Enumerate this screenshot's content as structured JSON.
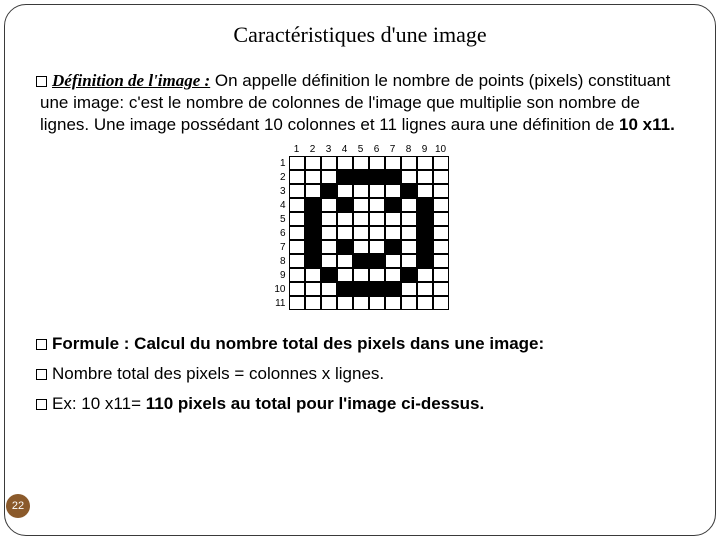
{
  "slide": {
    "title": "Caractéristiques d'une image",
    "page_number": "22"
  },
  "para1": {
    "lead": "Définition de l'image :",
    "rest_a": " On appelle définition le nombre de points (pixels) constituant une image: c'est le nombre de colonnes de l'image que multiplie son nombre de lignes. Une image possédant 10 colonnes et 11 lignes aura une définition de ",
    "bold_tail": "10 x11."
  },
  "para2": {
    "lead": "Formule : Calcul du nombre total des pixels dans une image:"
  },
  "para3": {
    "text": "Nombre total des pixels = colonnes x lignes."
  },
  "para4": {
    "pre": "Ex: 10 x11= ",
    "bold": "110 pixels au total pour l'image ci-dessus."
  },
  "chart_data": {
    "type": "table",
    "title": "Pixel grid 10x11 smiley",
    "columns": [
      "1",
      "2",
      "3",
      "4",
      "5",
      "6",
      "7",
      "8",
      "9",
      "10"
    ],
    "rows": [
      "1",
      "2",
      "3",
      "4",
      "5",
      "6",
      "7",
      "8",
      "9",
      "10",
      "11"
    ],
    "grid": [
      [
        0,
        0,
        0,
        0,
        0,
        0,
        0,
        0,
        0,
        0
      ],
      [
        0,
        0,
        0,
        1,
        1,
        1,
        1,
        0,
        0,
        0
      ],
      [
        0,
        0,
        1,
        0,
        0,
        0,
        0,
        1,
        0,
        0
      ],
      [
        0,
        1,
        0,
        1,
        0,
        0,
        1,
        0,
        1,
        0
      ],
      [
        0,
        1,
        0,
        0,
        0,
        0,
        0,
        0,
        1,
        0
      ],
      [
        0,
        1,
        0,
        0,
        0,
        0,
        0,
        0,
        1,
        0
      ],
      [
        0,
        1,
        0,
        1,
        0,
        0,
        1,
        0,
        1,
        0
      ],
      [
        0,
        1,
        0,
        0,
        1,
        1,
        0,
        0,
        1,
        0
      ],
      [
        0,
        0,
        1,
        0,
        0,
        0,
        0,
        1,
        0,
        0
      ],
      [
        0,
        0,
        0,
        1,
        1,
        1,
        1,
        0,
        0,
        0
      ],
      [
        0,
        0,
        0,
        0,
        0,
        0,
        0,
        0,
        0,
        0
      ]
    ]
  }
}
